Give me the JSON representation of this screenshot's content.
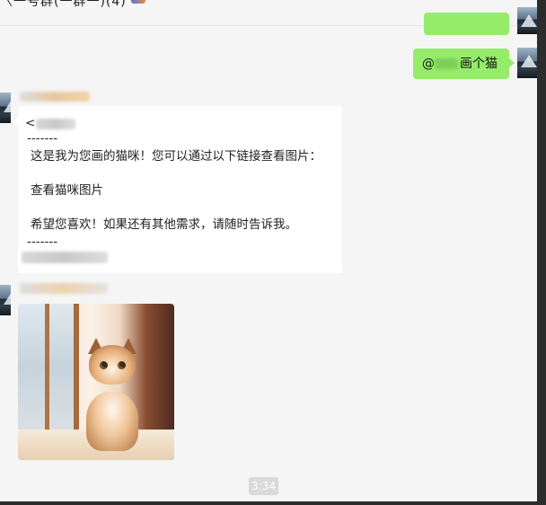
{
  "window": {
    "title": "〈一号群(一群一)(4)"
  },
  "messages": {
    "outgoing_text": "画个猫",
    "outgoing_at": "@",
    "bot_reply": {
      "prefix": "<",
      "separator_top": "-------",
      "line1": "这是我为您画的猫咪！您可以通过以下链接查看图片：",
      "link_text": "查看猫咪图片",
      "line3": "希望您喜欢！如果还有其他需求，请随时告诉我。",
      "separator_bottom": "-------"
    },
    "timestamp": "3:34"
  },
  "colors": {
    "outgoing_bubble": "#95ec69",
    "incoming_bubble": "#ffffff",
    "sender_name": "#e4a54a",
    "chat_background": "#f5f5f5"
  }
}
